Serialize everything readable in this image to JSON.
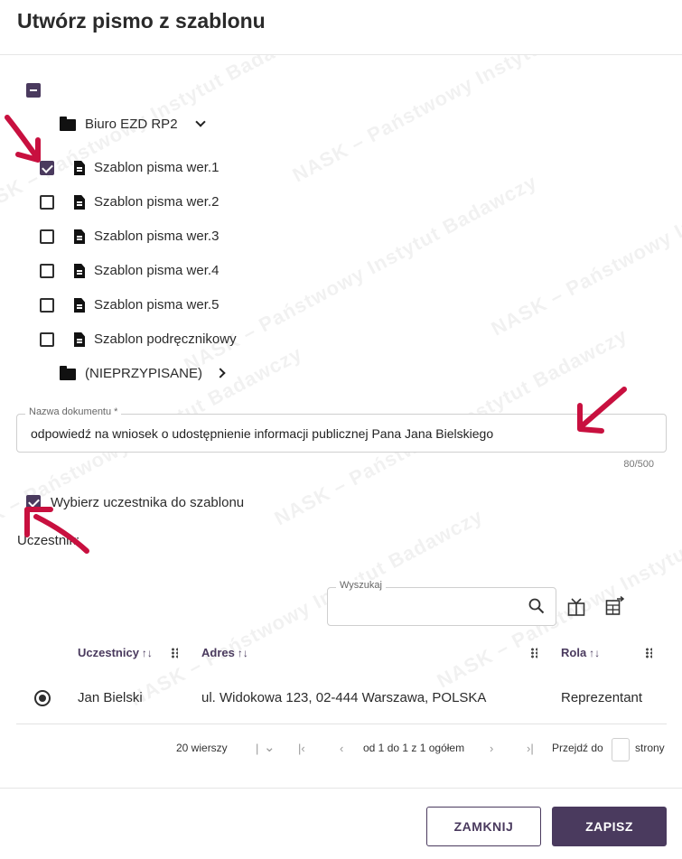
{
  "dialog": {
    "title": "Utwórz pismo z szablonu"
  },
  "tree": {
    "folders": [
      {
        "label": "Biuro EZD RP2",
        "expanded": true
      },
      {
        "label": "(NIEPRZYPISANE)",
        "expanded": false
      }
    ],
    "templates": [
      {
        "label": "Szablon pisma wer.1",
        "checked": true
      },
      {
        "label": "Szablon pisma wer.2",
        "checked": false
      },
      {
        "label": "Szablon pisma wer.3",
        "checked": false
      },
      {
        "label": "Szablon pisma wer.4",
        "checked": false
      },
      {
        "label": "Szablon pisma wer.5",
        "checked": false
      },
      {
        "label": "Szablon podręcznikowy",
        "checked": false
      }
    ]
  },
  "document_name": {
    "label": "Nazwa dokumentu *",
    "value": "odpowiedź na wniosek o udostępnienie informacji publicznej Pana Jana Bielskiego",
    "counter": "80/500"
  },
  "participant_option": {
    "label": "Wybierz uczestnika do szablonu",
    "checked": true
  },
  "participant_heading": "Uczestnik:",
  "search": {
    "label": "Wyszukaj",
    "value": ""
  },
  "table": {
    "columns": [
      "Uczestnicy",
      "Adres",
      "Rola"
    ],
    "sort_symbol": "↑↓",
    "rows": [
      {
        "name": "Jan Bielski",
        "address": "ul. Widokowa 123, 02-444 Warszawa, POLSKA",
        "role": "Reprezentant",
        "selected": true
      }
    ]
  },
  "pagination": {
    "rows_per_page": "20 wierszy",
    "range": "od 1 do 1 z 1 ogółem",
    "goto_label": "Przejdź do",
    "goto_suffix": "strony",
    "goto_value": ""
  },
  "buttons": {
    "close": "ZAMKNIJ",
    "save": "ZAPISZ"
  },
  "watermark": "NASK – Państwowy Instytut Badawczy",
  "colors": {
    "accent": "#4a3a5e",
    "annotation_arrow": "#c8103f"
  }
}
